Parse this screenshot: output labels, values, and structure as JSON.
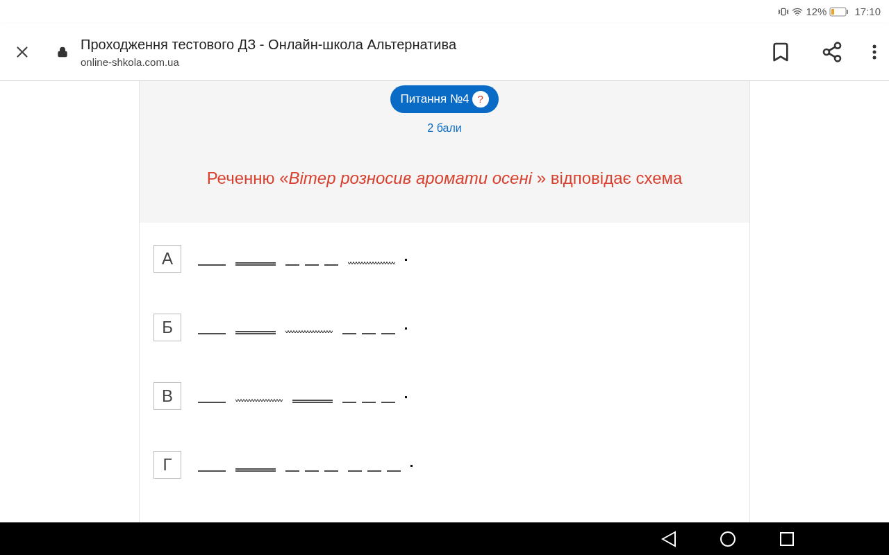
{
  "status_bar": {
    "battery": "12%",
    "time": "17:10"
  },
  "browser": {
    "title": "Проходження тестового ДЗ - Онлайн-школа Альтернатива",
    "url": "online-shkola.com.ua"
  },
  "question": {
    "badge": "Питання №4",
    "help": "?",
    "points": "2 бали",
    "text": "Реченню «*Вітер розносив аромати осені* » відповідає схема"
  },
  "options": [
    {
      "letter": "А",
      "scheme": [
        {
          "kind": "single"
        },
        {
          "kind": "double"
        },
        {
          "kind": "dashed"
        },
        {
          "kind": "wavy"
        },
        {
          "kind": "dot"
        }
      ]
    },
    {
      "letter": "Б",
      "scheme": [
        {
          "kind": "single"
        },
        {
          "kind": "double"
        },
        {
          "kind": "wavy"
        },
        {
          "kind": "dashed"
        },
        {
          "kind": "dot"
        }
      ]
    },
    {
      "letter": "В",
      "scheme": [
        {
          "kind": "single"
        },
        {
          "kind": "wavy"
        },
        {
          "kind": "double"
        },
        {
          "kind": "dashed"
        },
        {
          "kind": "dot"
        }
      ]
    },
    {
      "letter": "Г",
      "scheme": [
        {
          "kind": "single"
        },
        {
          "kind": "double"
        },
        {
          "kind": "dashed"
        },
        {
          "kind": "dashed"
        },
        {
          "kind": "dot"
        }
      ]
    }
  ]
}
